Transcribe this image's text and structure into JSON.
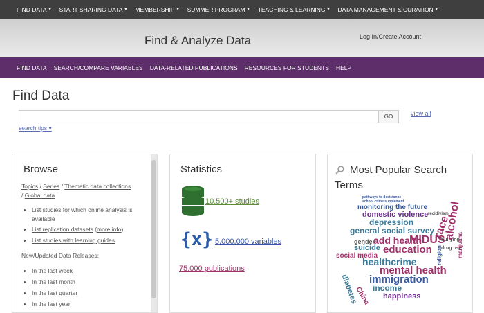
{
  "topnav": [
    {
      "label": "FIND DATA",
      "caret": "▾"
    },
    {
      "label": "START SHARING DATA",
      "caret": "▾"
    },
    {
      "label": "MEMBERSHIP",
      "caret": "▾"
    },
    {
      "label": "SUMMER PROGRAM",
      "caret": "▾"
    },
    {
      "label": "TEACHING & LEARNING",
      "caret": "▾"
    },
    {
      "label": "DATA MANAGEMENT & CURATION",
      "caret": "▾"
    }
  ],
  "hero": {
    "title": "Find & Analyze Data",
    "login": "Log In/Create Account"
  },
  "subnav": [
    "FIND DATA",
    "SEARCH/COMPARE VARIABLES",
    "DATA-RELATED PUBLICATIONS",
    "RESOURCES FOR STUDENTS",
    "HELP"
  ],
  "find": {
    "title": "Find Data",
    "search_placeholder": "",
    "go_label": "GO",
    "view_all": "view all",
    "search_tips": "search tips ▾"
  },
  "browse": {
    "title": "Browse",
    "topics": "Topics",
    "series": "Series",
    "thematic": "Thematic data collections",
    "global": "Global data",
    "sep": " / ",
    "list_online": "List studies for which online analysis is available",
    "list_replication": "List replication datasets",
    "more_info": "more info",
    "list_guides": "List studies with learning guides",
    "new_heading": "New/Updated Data Releases:",
    "last_week": "In the last week",
    "last_month": "In the last month",
    "last_quarter": "In the last quarter",
    "last_year": "In the last year"
  },
  "stats": {
    "title": "Statistics",
    "studies": "10,500+ studies",
    "x_glyph": "{x}",
    "variables": "5,000,000 variables",
    "publications": "75,000 publications"
  },
  "popular": {
    "title_line1": "Most Popular Search",
    "title_line2": "Terms",
    "search_icon": "search-icon",
    "words": [
      {
        "text": "pathways to desistance",
        "color": "#3a5aa0"
      },
      {
        "text": "school crime supplement",
        "color": "#3a5aa0"
      },
      {
        "text": "monitoring the future",
        "color": "#3a5aa0"
      },
      {
        "text": "domestic violence",
        "color": "#6b2f8c"
      },
      {
        "text": "recidivism",
        "color": "#555"
      },
      {
        "text": "depression",
        "color": "#3a7a9a"
      },
      {
        "text": "general social survey",
        "color": "#3a7a9a"
      },
      {
        "text": "add health",
        "color": "#a0306a"
      },
      {
        "text": "MIDUS",
        "color": "#a0306a"
      },
      {
        "text": "education",
        "color": "#a0306a"
      },
      {
        "text": "suicide",
        "color": "#3a7a9a"
      },
      {
        "text": "gender",
        "color": "#555"
      },
      {
        "text": "social media",
        "color": "#a0306a"
      },
      {
        "text": "healthcrime",
        "color": "#3a7a9a"
      },
      {
        "text": "mental health",
        "color": "#a0306a"
      },
      {
        "text": "immigration",
        "color": "#3a5aa0"
      },
      {
        "text": "income",
        "color": "#3a7a9a"
      },
      {
        "text": "happiness",
        "color": "#6b2f8c"
      },
      {
        "text": "race",
        "color": "#a0306a"
      },
      {
        "text": "alcohol",
        "color": "#a0306a"
      },
      {
        "text": "bullying",
        "color": "#555"
      },
      {
        "text": "drug use",
        "color": "#555"
      },
      {
        "text": "religion",
        "color": "#3a5aa0"
      },
      {
        "text": "marijuana",
        "color": "#a0306a"
      },
      {
        "text": "China",
        "color": "#a0306a"
      },
      {
        "text": "diabetes",
        "color": "#3a7a9a"
      }
    ]
  },
  "colors": {
    "topnav_bg": "#3f3f3f",
    "subnav_bg": "#5e2e6a",
    "link": "#5b6ab0"
  }
}
